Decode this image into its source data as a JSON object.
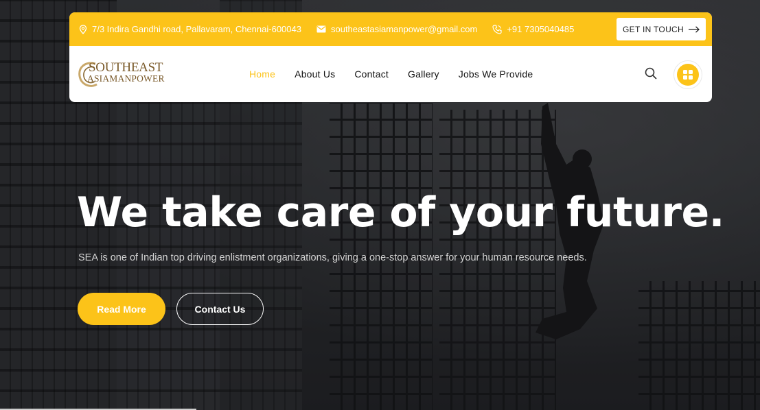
{
  "topbar": {
    "address": "7/3 Indira Gandhi road, Pallavaram, Chennai-600043",
    "email": "southeastasiamanpower@gmail.com",
    "phone": "+91 7305040485",
    "cta_label": "GET IN TOUCH"
  },
  "logo": {
    "line1": "SOUTHEAST",
    "line2": "ASIAMANPOWER"
  },
  "nav": {
    "items": [
      {
        "label": "Home",
        "active": true
      },
      {
        "label": "About Us",
        "active": false
      },
      {
        "label": "Contact",
        "active": false
      },
      {
        "label": "Gallery",
        "active": false
      },
      {
        "label": "Jobs We Provide",
        "active": false
      }
    ]
  },
  "hero": {
    "headline": "We take care of your future.",
    "subtext": "SEA is one of Indian top driving enlistment organizations, giving a one-stop answer for your human resource needs.",
    "primary_button": "Read More",
    "secondary_button": "Contact Us"
  },
  "colors": {
    "accent": "#fcc319",
    "text_dark": "#111111",
    "logo_brown": "#7a5a2a"
  },
  "icons": {
    "address": "location-pin-icon",
    "email": "envelope-icon",
    "phone": "phone-icon",
    "cta": "arrow-right-icon",
    "search": "search-icon",
    "apps": "grid-icon"
  }
}
